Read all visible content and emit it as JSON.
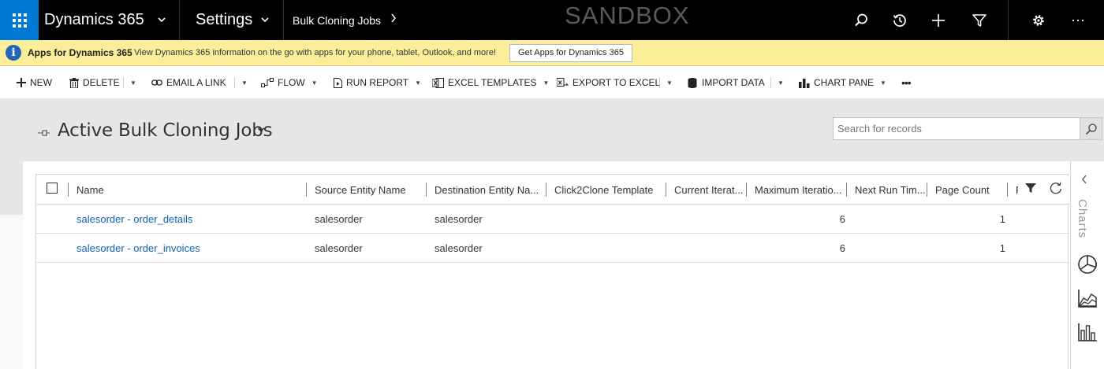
{
  "topbar": {
    "app_name": "Dynamics 365",
    "area": "Settings",
    "breadcrumb": "Bulk Cloning Jobs",
    "environment": "SANDBOX",
    "icons": [
      "search-icon",
      "recent-icon",
      "new-icon",
      "filter-icon",
      "gear-icon",
      "more-icon"
    ]
  },
  "notification": {
    "title": "Apps for Dynamics 365",
    "message": "View Dynamics 365 information on the go with apps for your phone, tablet, Outlook, and more!",
    "button": "Get Apps for Dynamics 365"
  },
  "commands": {
    "new": "NEW",
    "delete": "DELETE",
    "email_link": "EMAIL A LINK",
    "flow": "FLOW",
    "run_report": "RUN REPORT",
    "excel_templates": "EXCEL TEMPLATES",
    "export_excel": "EXPORT TO EXCEL",
    "import_data": "IMPORT DATA",
    "chart_pane": "CHART PANE",
    "more": "•••"
  },
  "view": {
    "title": "Active Bulk Cloning Jobs",
    "search_placeholder": "Search for records"
  },
  "grid": {
    "columns": {
      "name": "Name",
      "source": "Source Entity Name",
      "destination": "Destination Entity Na...",
      "template": "Click2Clone Template",
      "current": "Current Iterat...",
      "maximum": "Maximum Iteratio...",
      "next_run": "Next Run Tim...",
      "page_count": "Page Count",
      "partial": "P"
    },
    "rows": [
      {
        "name": "salesorder - order_details",
        "source": "salesorder",
        "destination": "salesorder",
        "template": "",
        "current": "",
        "maximum": "6",
        "next_run": "",
        "page_count": "1"
      },
      {
        "name": "salesorder - order_invoices",
        "source": "salesorder",
        "destination": "salesorder",
        "template": "",
        "current": "",
        "maximum": "6",
        "next_run": "",
        "page_count": "1"
      }
    ]
  },
  "charts_pane": {
    "label": "Charts",
    "icons": [
      "pie-chart-icon",
      "area-chart-icon",
      "bar-chart-icon"
    ]
  },
  "colors": {
    "topbar": "#000000",
    "waffle": "#0078d4",
    "notification": "#fbee9b",
    "link": "#1160b7",
    "view_header": "#e7e7e7"
  }
}
